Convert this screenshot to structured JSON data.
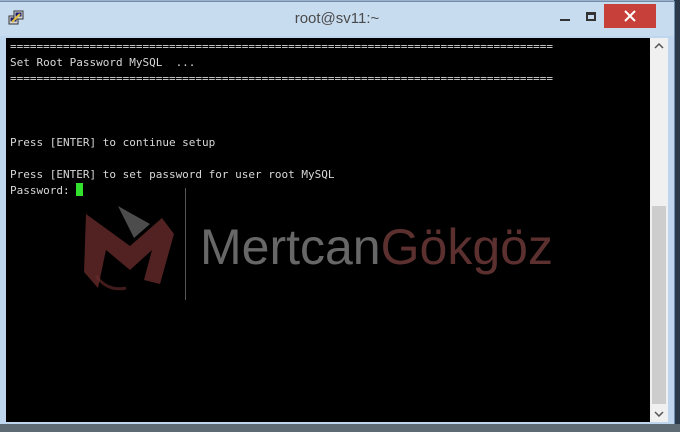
{
  "window": {
    "title": "root@sv11:~"
  },
  "terminal": {
    "lines": [
      "==================================================================================",
      "Set Root Password MySQL  ...",
      "==================================================================================",
      "",
      "",
      "",
      "Press [ENTER] to continue setup",
      "",
      "Press [ENTER] to set password for user root MySQL"
    ],
    "prompt": "Password: "
  },
  "watermark": {
    "name_part1": "Mertcan",
    "name_part2": "Gökgöz"
  },
  "colors": {
    "terminal_bg": "#000000",
    "terminal_fg": "#d8d8d8",
    "cursor": "#32e02e",
    "close_button": "#c7403a",
    "watermark_red": "#7d4040"
  }
}
